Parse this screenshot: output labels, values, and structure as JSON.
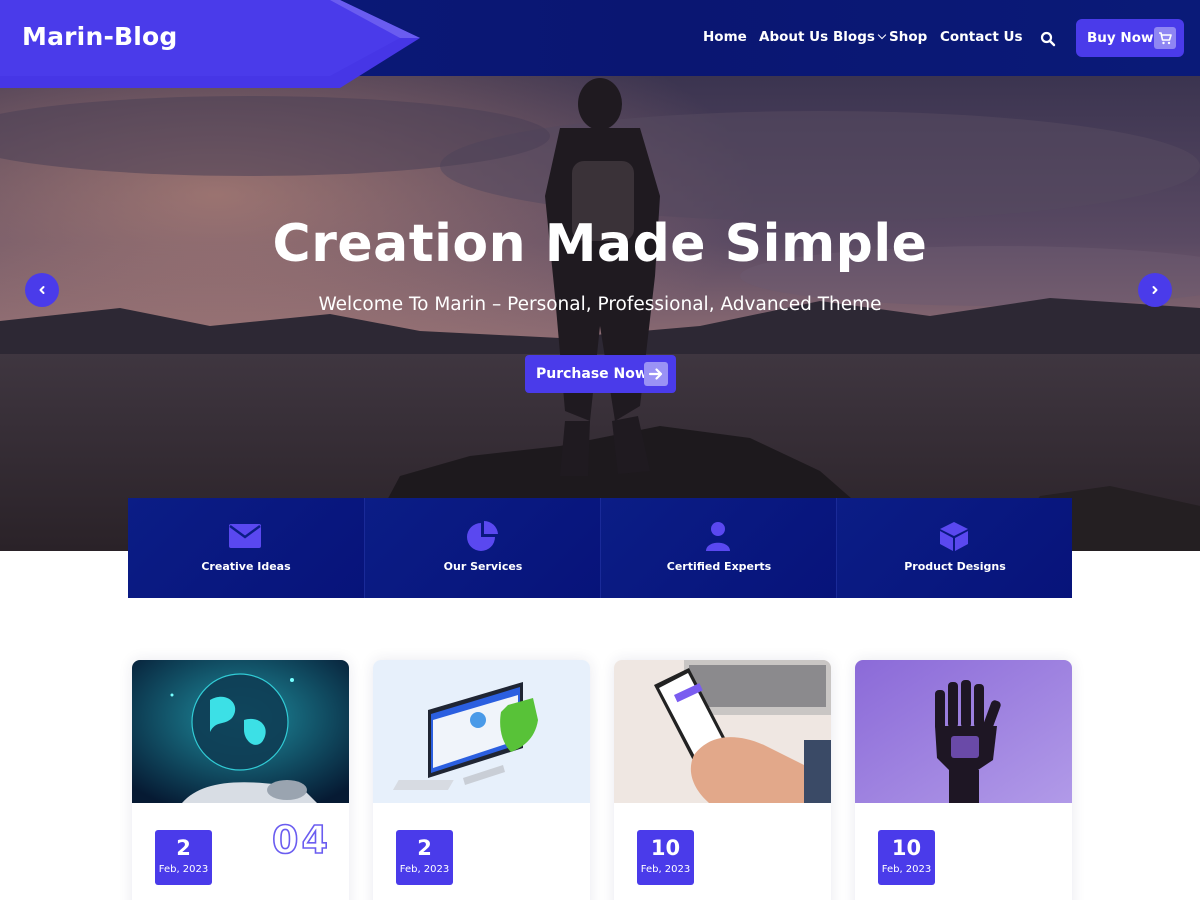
{
  "brand": {
    "name": "Marin-Blog",
    "accent": "#4a3bea",
    "header_navy": "#0a1672"
  },
  "nav": {
    "items": [
      {
        "label": "Home"
      },
      {
        "label": "About Us"
      },
      {
        "label": "Blogs",
        "has_dropdown": true
      },
      {
        "label": "Shop"
      },
      {
        "label": "Contact Us"
      }
    ],
    "search_icon": "search-icon",
    "buy_button": {
      "label": "Buy Now",
      "icon": "cart-icon"
    }
  },
  "hero": {
    "title": "Creation Made Simple",
    "subtitle": "Welcome To Marin – Personal, Professional, Advanced Theme",
    "button": {
      "label": "Purchase Now",
      "icon": "arrow-right-icon"
    },
    "prev_icon": "chevron-left-icon",
    "next_icon": "chevron-right-icon"
  },
  "features": [
    {
      "label": "Creative Ideas",
      "icon": "envelope-icon"
    },
    {
      "label": "Our Services",
      "icon": "pie-chart-icon"
    },
    {
      "label": "Certified Experts",
      "icon": "user-icon"
    },
    {
      "label": "Product Designs",
      "icon": "cube-icon"
    }
  ],
  "posts": [
    {
      "day": "2",
      "month_year": "Feb, 2023",
      "number": "04",
      "thumb": "globe-robot-hand-image"
    },
    {
      "day": "2",
      "month_year": "Feb, 2023",
      "number": "",
      "thumb": "computer-security-shield-image"
    },
    {
      "day": "10",
      "month_year": "Feb, 2023",
      "number": "",
      "thumb": "hand-holding-phone-image"
    },
    {
      "day": "10",
      "month_year": "Feb, 2023",
      "number": "",
      "thumb": "robotic-hand-image"
    }
  ]
}
